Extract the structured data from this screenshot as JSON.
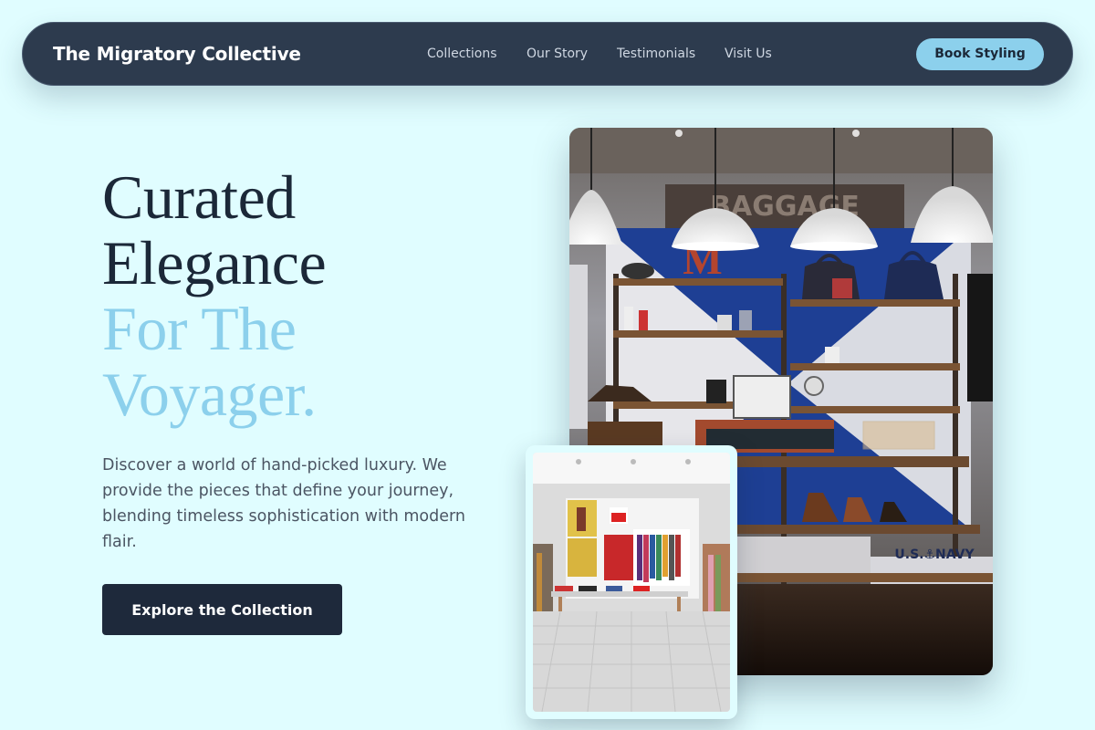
{
  "header": {
    "brand": "The Migratory Collective",
    "nav": [
      {
        "label": "Collections"
      },
      {
        "label": "Our Story"
      },
      {
        "label": "Testimonials"
      },
      {
        "label": "Visit Us"
      }
    ],
    "cta_label": "Book Styling"
  },
  "hero": {
    "headline_dark": [
      "Curated",
      "Elegance"
    ],
    "headline_accent": [
      "For The",
      "Voyager."
    ],
    "description": "Discover a world of hand-picked luxury. We provide the pieces that define your journey, blending timeless sophistication with modern flair.",
    "cta_label": "Explore the Collection"
  },
  "images": {
    "main": {
      "alt": "Boutique interior with pendant lamps, wooden shelves with bags and shoes",
      "sign_text": "BAGGAGE",
      "letter": "M",
      "shirt_text": "U.S.⚓NAVY"
    },
    "secondary": {
      "alt": "Bright white clothing store with garment racks and display table"
    }
  },
  "colors": {
    "background": "#e0fdff",
    "navbar": "#2d3b4e",
    "accent": "#8cd0ec",
    "dark": "#1b2838"
  }
}
